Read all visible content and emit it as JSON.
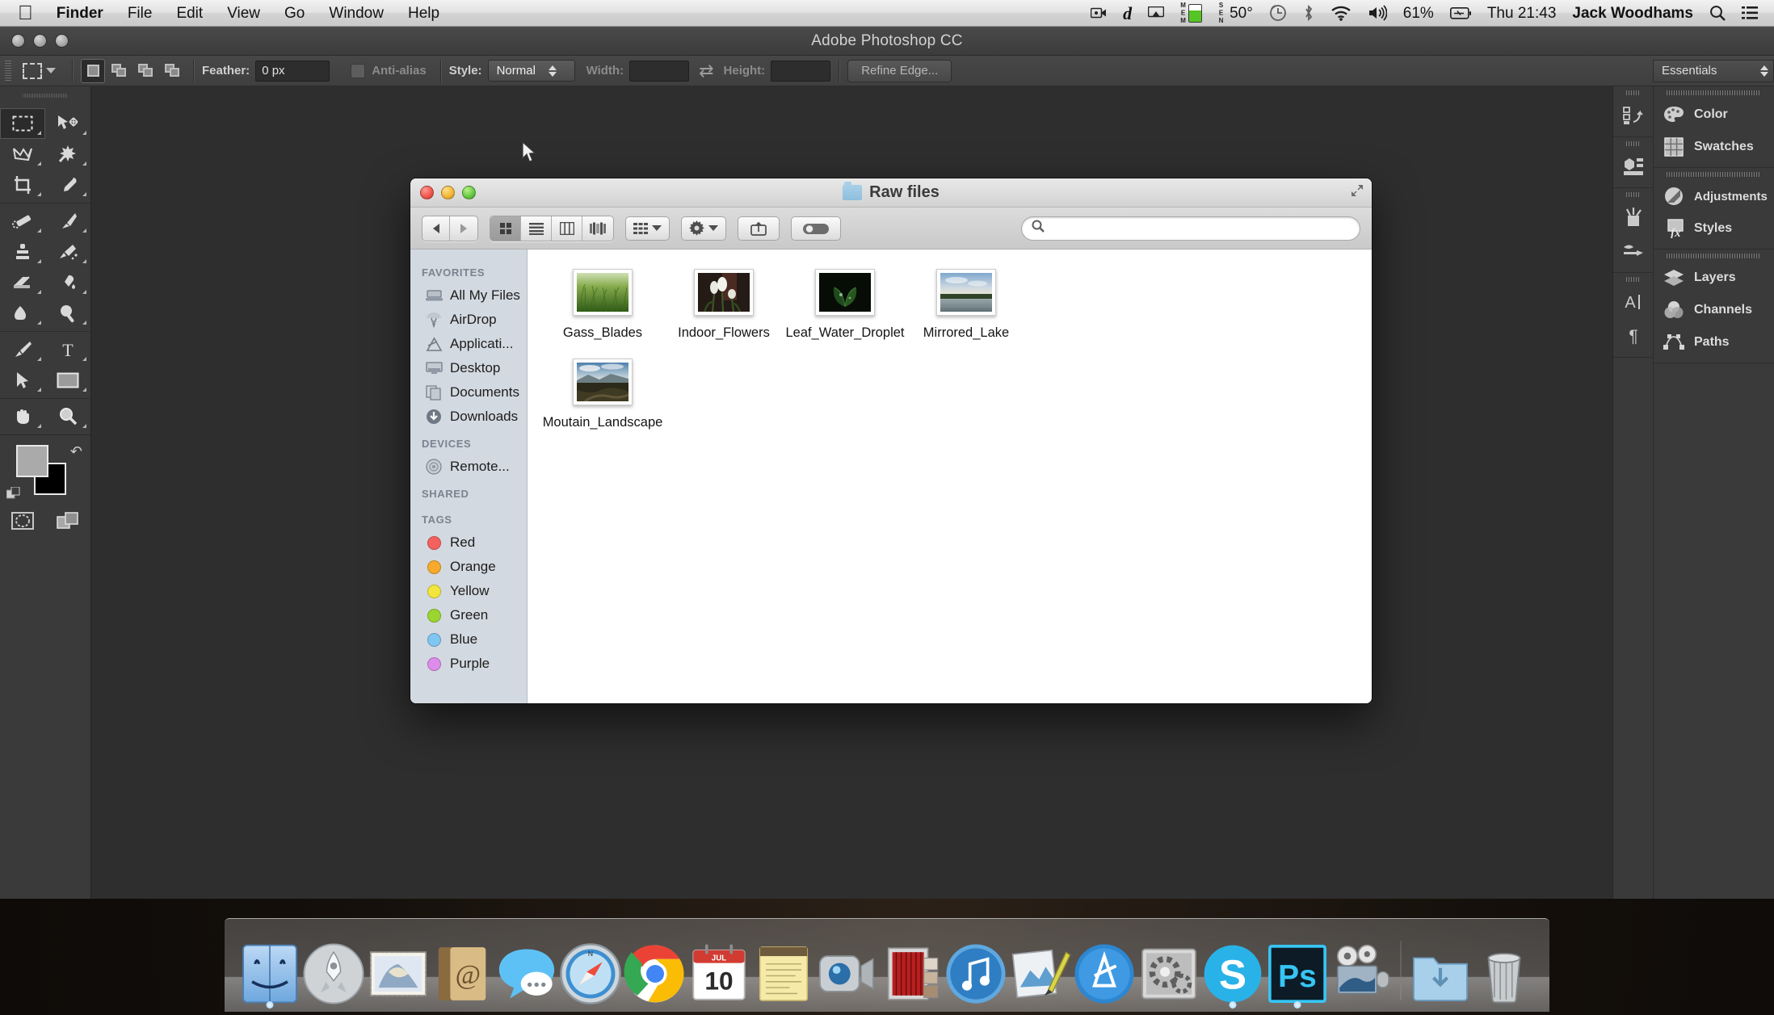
{
  "menubar": {
    "apple_icon": "apple-logo",
    "items": [
      {
        "label": "Finder",
        "bold": true
      },
      {
        "label": "File",
        "bold": false
      },
      {
        "label": "Edit",
        "bold": false
      },
      {
        "label": "View",
        "bold": false
      },
      {
        "label": "Go",
        "bold": false
      },
      {
        "label": "Window",
        "bold": false
      },
      {
        "label": "Help",
        "bold": false
      }
    ],
    "status": {
      "screen_recorder_icon": "screen-record-icon",
      "dropbox_icon": "d-letter-icon",
      "airplay_icon": "airplay-icon",
      "mem_label": "MEM",
      "sen_label": "SEN",
      "temperature": "50°",
      "timemachine_icon": "time-machine-icon",
      "bluetooth_icon": "bluetooth-icon",
      "wifi_icon": "wifi-icon",
      "volume_icon": "volume-icon",
      "battery_percent": "61%",
      "battery_icon": "battery-icon",
      "datetime": "Thu 21:43",
      "user": "Jack Woodhams",
      "spotlight_icon": "search-icon",
      "notifications_icon": "notification-center-icon"
    }
  },
  "photoshop": {
    "title": "Adobe Photoshop CC",
    "options": {
      "tool_icon": "rectangular-marquee-icon",
      "selection_modes": [
        "new-selection",
        "add-to-selection",
        "subtract-from-selection",
        "intersect-selection"
      ],
      "feather_label": "Feather:",
      "feather_value": "0 px",
      "antialias_label": "Anti-alias",
      "style_label": "Style:",
      "style_value": "Normal",
      "width_label": "Width:",
      "width_value": "",
      "swap_icon": "swap-dimensions-icon",
      "height_label": "Height:",
      "height_value": "",
      "refine_edge_label": "Refine Edge...",
      "workspace": "Essentials"
    },
    "tools": [
      [
        {
          "name": "rectangular-marquee-tool",
          "active": true
        },
        {
          "name": "move-tool",
          "active": false
        }
      ],
      [
        {
          "name": "lasso-tool",
          "active": false
        },
        {
          "name": "magic-wand-tool",
          "active": false
        }
      ],
      [
        {
          "name": "crop-tool",
          "active": false
        },
        {
          "name": "eyedropper-tool",
          "active": false
        }
      ],
      [
        {
          "name": "healing-brush-tool",
          "active": false
        },
        {
          "name": "brush-tool",
          "active": false
        }
      ],
      [
        {
          "name": "clone-stamp-tool",
          "active": false
        },
        {
          "name": "history-brush-tool",
          "active": false
        }
      ],
      [
        {
          "name": "eraser-tool",
          "active": false
        },
        {
          "name": "gradient-tool",
          "active": false
        }
      ],
      [
        {
          "name": "blur-tool",
          "active": false
        },
        {
          "name": "dodge-tool",
          "active": false
        }
      ],
      [
        {
          "name": "pen-tool",
          "active": false
        },
        {
          "name": "type-tool",
          "active": false
        }
      ],
      [
        {
          "name": "path-selection-tool",
          "active": false
        },
        {
          "name": "rectangle-tool",
          "active": false
        }
      ],
      [
        {
          "name": "hand-tool",
          "active": false
        },
        {
          "name": "zoom-tool",
          "active": false
        }
      ]
    ],
    "color_wells": {
      "foreground": "#aaaaaa",
      "background": "#000000",
      "swap_icon": "swap-colors-icon",
      "default_icon": "default-colors-icon"
    },
    "bottom_tools": [
      {
        "name": "quick-mask-toggle"
      },
      {
        "name": "screen-mode-toggle"
      }
    ],
    "icon_panels": [
      [
        {
          "name": "history-panel-icon"
        }
      ],
      [
        {
          "name": "properties-panel-icon"
        }
      ],
      [
        {
          "name": "brush-panel-icon"
        },
        {
          "name": "brush-presets-panel-icon"
        }
      ],
      [
        {
          "name": "character-panel-icon"
        },
        {
          "name": "paragraph-panel-icon"
        }
      ]
    ],
    "panel_groups": [
      {
        "items": [
          {
            "label": "Color",
            "icon": "color-palette-icon"
          },
          {
            "label": "Swatches",
            "icon": "swatches-grid-icon"
          }
        ]
      },
      {
        "items": [
          {
            "label": "Adjustments",
            "icon": "adjustments-circle-icon"
          },
          {
            "label": "Styles",
            "icon": "styles-fx-icon"
          }
        ]
      },
      {
        "items": [
          {
            "label": "Layers",
            "icon": "layers-stack-icon"
          },
          {
            "label": "Channels",
            "icon": "channels-venn-icon"
          },
          {
            "label": "Paths",
            "icon": "paths-bezier-icon"
          }
        ]
      }
    ]
  },
  "finder": {
    "title": "Raw files",
    "folder_icon": "folder-icon",
    "fullscreen_icon": "fullscreen-icon",
    "toolbar": {
      "back_icon": "back-arrow-icon",
      "forward_icon": "forward-arrow-icon",
      "view_modes": [
        {
          "name": "icon-view",
          "active": true
        },
        {
          "name": "list-view",
          "active": false
        },
        {
          "name": "column-view",
          "active": false
        },
        {
          "name": "coverflow-view",
          "active": false
        }
      ],
      "arrange_icon": "arrange-by-icon",
      "action_icon": "gear-icon",
      "share_icon": "share-icon",
      "tags_icon": "edit-tags-icon",
      "search_placeholder": "",
      "search_value": "",
      "search_icon": "search-icon"
    },
    "sidebar": {
      "sections": [
        {
          "title": "FAVORITES",
          "items": [
            {
              "label": "All My Files",
              "icon": "all-my-files-icon"
            },
            {
              "label": "AirDrop",
              "icon": "airdrop-icon"
            },
            {
              "label": "Applicati...",
              "icon": "applications-icon"
            },
            {
              "label": "Desktop",
              "icon": "desktop-icon"
            },
            {
              "label": "Documents",
              "icon": "documents-icon"
            },
            {
              "label": "Downloads",
              "icon": "downloads-icon"
            }
          ]
        },
        {
          "title": "DEVICES",
          "items": [
            {
              "label": "Remote...",
              "icon": "remote-disc-icon"
            }
          ]
        },
        {
          "title": "SHARED",
          "items": []
        },
        {
          "title": "TAGS",
          "items": [
            {
              "label": "Red",
              "icon": "tag-dot",
              "color": "#f4615e"
            },
            {
              "label": "Orange",
              "icon": "tag-dot",
              "color": "#f7aa2b"
            },
            {
              "label": "Yellow",
              "icon": "tag-dot",
              "color": "#f2e53c"
            },
            {
              "label": "Green",
              "icon": "tag-dot",
              "color": "#9ad62f"
            },
            {
              "label": "Blue",
              "icon": "tag-dot",
              "color": "#7fc6f2"
            },
            {
              "label": "Purple",
              "icon": "tag-dot",
              "color": "#dd8cea"
            }
          ]
        }
      ]
    },
    "files": [
      {
        "label": "Gass_Blades",
        "thumb": "grass-photo"
      },
      {
        "label": "Indoor_Flowers",
        "thumb": "flowers-photo"
      },
      {
        "label": "Leaf_Water_Droplet",
        "thumb": "leaf-photo"
      },
      {
        "label": "Mirrored_Lake",
        "thumb": "lake-photo"
      },
      {
        "label": "Moutain_Landscape",
        "thumb": "mountain-photo"
      }
    ]
  },
  "dock": {
    "items": [
      {
        "name": "finder",
        "running": true
      },
      {
        "name": "launchpad",
        "running": false
      },
      {
        "name": "mail",
        "running": false
      },
      {
        "name": "contacts",
        "running": false
      },
      {
        "name": "messages",
        "running": false
      },
      {
        "name": "safari",
        "running": false
      },
      {
        "name": "chrome",
        "running": true
      },
      {
        "name": "calendar",
        "running": false,
        "month": "JUL",
        "day": "10"
      },
      {
        "name": "notes",
        "running": false
      },
      {
        "name": "facetime",
        "running": false
      },
      {
        "name": "iphoto",
        "running": false
      },
      {
        "name": "itunes",
        "running": false
      },
      {
        "name": "preview",
        "running": false
      },
      {
        "name": "app-store",
        "running": false
      },
      {
        "name": "system-preferences",
        "running": false
      },
      {
        "name": "skype",
        "running": true
      },
      {
        "name": "photoshop",
        "running": true
      },
      {
        "name": "imovie",
        "running": false
      }
    ],
    "trailing": [
      {
        "name": "downloads-folder"
      },
      {
        "name": "trash"
      }
    ]
  }
}
